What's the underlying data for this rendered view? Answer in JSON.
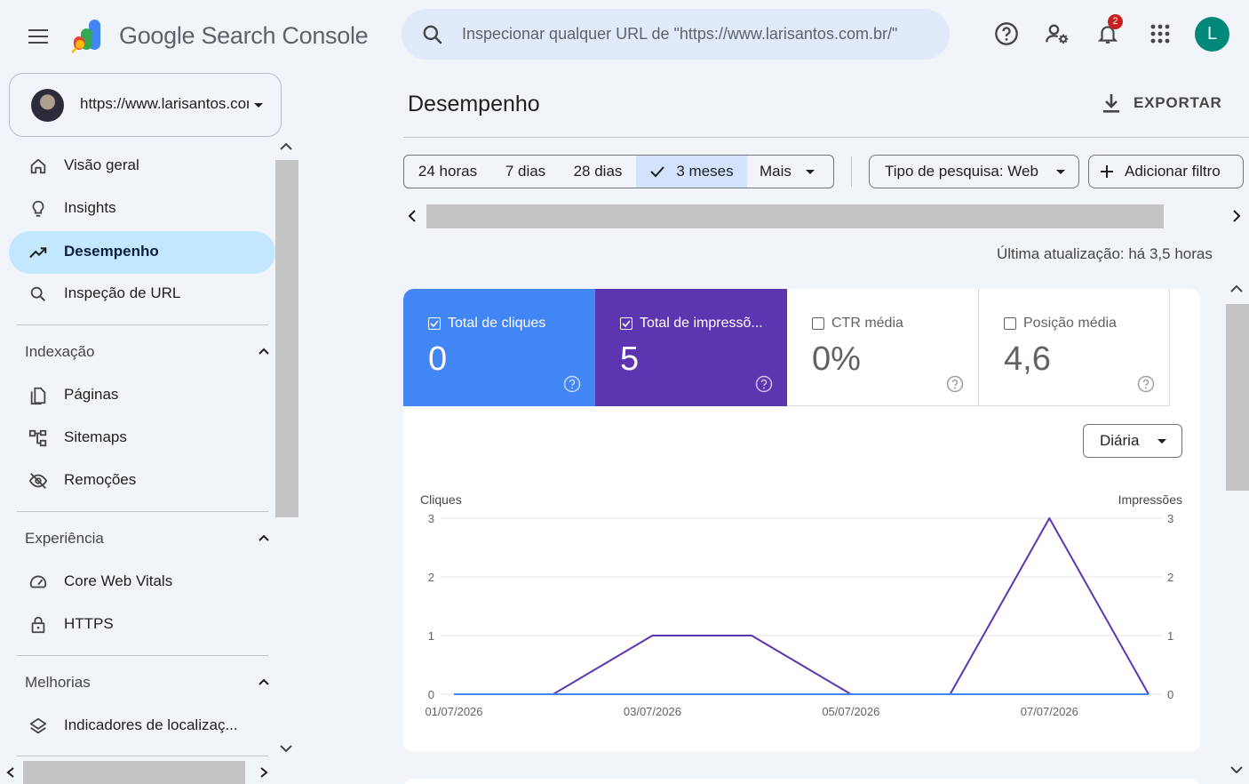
{
  "header": {
    "app_name": "Google Search Console",
    "search_placeholder": "Inspecionar qualquer URL de \"https://www.larisantos.com.br/\"",
    "notification_count": "2",
    "avatar_letter": "L"
  },
  "property": {
    "url": "https://www.larisantos.com.br/"
  },
  "sidebar": {
    "items": [
      {
        "label": "Visão geral",
        "icon": "home-icon"
      },
      {
        "label": "Insights",
        "icon": "lightbulb-icon"
      },
      {
        "label": "Desempenho",
        "icon": "trending-up-icon",
        "active": true
      },
      {
        "label": "Inspeção de URL",
        "icon": "search-icon"
      }
    ],
    "sections": [
      {
        "title": "Indexação",
        "items": [
          {
            "label": "Páginas",
            "icon": "pages-icon"
          },
          {
            "label": "Sitemaps",
            "icon": "sitemap-icon"
          },
          {
            "label": "Remoções",
            "icon": "eye-off-icon"
          }
        ]
      },
      {
        "title": "Experiência",
        "items": [
          {
            "label": "Core Web Vitals",
            "icon": "speed-icon"
          },
          {
            "label": "HTTPS",
            "icon": "lock-icon"
          }
        ]
      },
      {
        "title": "Melhorias",
        "items": [
          {
            "label": "Indicadores de localizaç...",
            "icon": "layers-icon"
          }
        ]
      }
    ]
  },
  "main": {
    "title": "Desempenho",
    "export_label": "EXPORTAR",
    "date_chips": [
      "24 horas",
      "7 dias",
      "28 dias",
      "3 meses",
      "Mais"
    ],
    "selected_chip": "3 meses",
    "search_type": "Tipo de pesquisa: Web",
    "add_filter": "Adicionar filtro",
    "last_update": "Última atualização: há 3,5 horas",
    "granularity": "Diária"
  },
  "metrics": [
    {
      "label": "Total de cliques",
      "value": "0",
      "checked": true,
      "color": "#4285f4"
    },
    {
      "label": "Total de impressõ...",
      "value": "5",
      "checked": true,
      "color": "#5e35b1"
    },
    {
      "label": "CTR média",
      "value": "0%",
      "checked": false,
      "color": "#ffffff"
    },
    {
      "label": "Posição média",
      "value": "4,6",
      "checked": false,
      "color": "#ffffff"
    }
  ],
  "chart_data": {
    "type": "line",
    "x": [
      "01/07/2026",
      "02/07/2026",
      "03/07/2026",
      "04/07/2026",
      "05/07/2026",
      "06/07/2026",
      "07/07/2026",
      "08/07/2026"
    ],
    "x_tick_labels": [
      "01/07/2026",
      "03/07/2026",
      "05/07/2026",
      "07/07/2026"
    ],
    "ylabel": "Cliques",
    "y2label": "Impressões",
    "ylim": [
      0,
      3
    ],
    "y2lim": [
      0,
      3
    ],
    "y_ticks": [
      0,
      1,
      2,
      3
    ],
    "grid": true,
    "series": [
      {
        "name": "Cliques",
        "axis": "left",
        "color": "#4285f4",
        "values": [
          0,
          0,
          0,
          0,
          0,
          0,
          0,
          0
        ]
      },
      {
        "name": "Impressões",
        "axis": "right",
        "color": "#5e35b1",
        "values": [
          0,
          0,
          1,
          1,
          0,
          0,
          3,
          0
        ]
      }
    ]
  }
}
